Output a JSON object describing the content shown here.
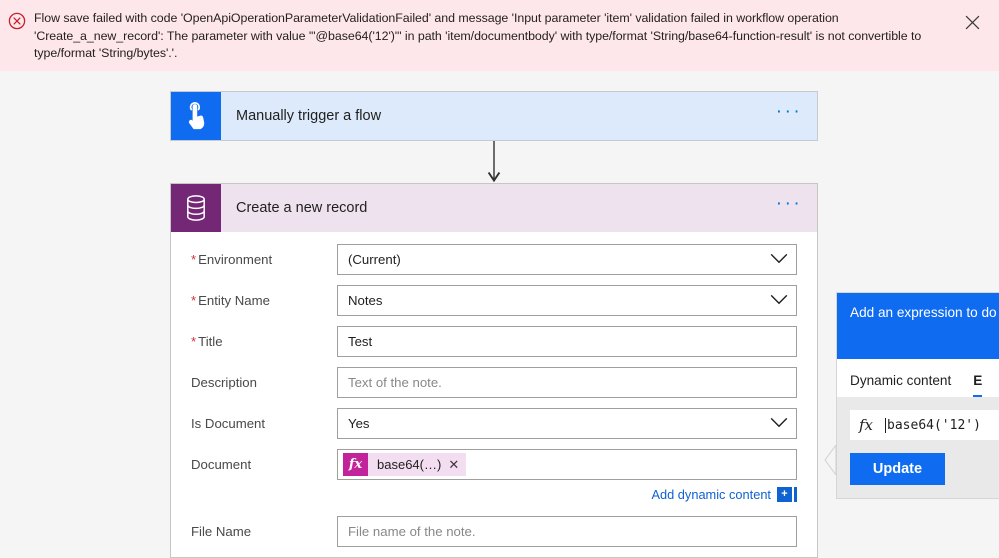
{
  "error_banner": {
    "icon": "error-circle-x-icon",
    "message": "Flow save failed with code 'OpenApiOperationParameterValidationFailed' and message 'Input parameter 'item' validation failed in workflow operation 'Create_a_new_record': The parameter with value '\"@base64('12')\"' in path 'item/documentbody' with type/format 'String/base64-function-result' is not convertible to type/format 'String/bytes'.'.",
    "close_label": "✕",
    "background_color": "#fde7ea",
    "icon_color": "#c8202a"
  },
  "trigger_card": {
    "title": "Manually trigger a flow",
    "icon": "tap-gesture-icon",
    "menu_label": "···",
    "icon_background": "#0f6cf0",
    "card_background": "#dceafb"
  },
  "action_card": {
    "title": "Create a new record",
    "icon": "database-icon",
    "menu_label": "···",
    "icon_background": "#742774",
    "header_background": "#eee2ee",
    "fields": [
      {
        "label": "Environment",
        "required": true,
        "type": "dropdown",
        "value": "(Current)",
        "placeholder": ""
      },
      {
        "label": "Entity Name",
        "required": true,
        "type": "dropdown",
        "value": "Notes",
        "placeholder": ""
      },
      {
        "label": "Title",
        "required": true,
        "type": "text",
        "value": "Test",
        "placeholder": ""
      },
      {
        "label": "Description",
        "required": false,
        "type": "text",
        "value": "",
        "placeholder": "Text of the note."
      },
      {
        "label": "Is Document",
        "required": false,
        "type": "dropdown",
        "value": "Yes",
        "placeholder": ""
      },
      {
        "label": "Document",
        "required": false,
        "type": "token",
        "value": "base64(…)",
        "placeholder": ""
      },
      {
        "label": "File Name",
        "required": false,
        "type": "text",
        "value": "",
        "placeholder": "File name of the note."
      }
    ],
    "token": {
      "fx_label": "fx",
      "text": "base64(…)",
      "remove_label": "✕",
      "fx_color": "#c2239b",
      "pill_color": "#f3ddf0"
    },
    "add_dynamic_content": {
      "label": "Add dynamic content",
      "plus_label": "+",
      "link_color": "#0f62d1"
    }
  },
  "expression_panel": {
    "header_text": "Add an expression to do convert, and compare va",
    "header_color": "#0f6cf0",
    "tabs": [
      {
        "label": "Dynamic content",
        "active": false
      },
      {
        "label": "E",
        "active": true
      }
    ],
    "expression_input": {
      "fx_label": "fx",
      "value": "base64('12')"
    },
    "update_button": "Update",
    "collapse_icon": "chevron-left-icon"
  }
}
